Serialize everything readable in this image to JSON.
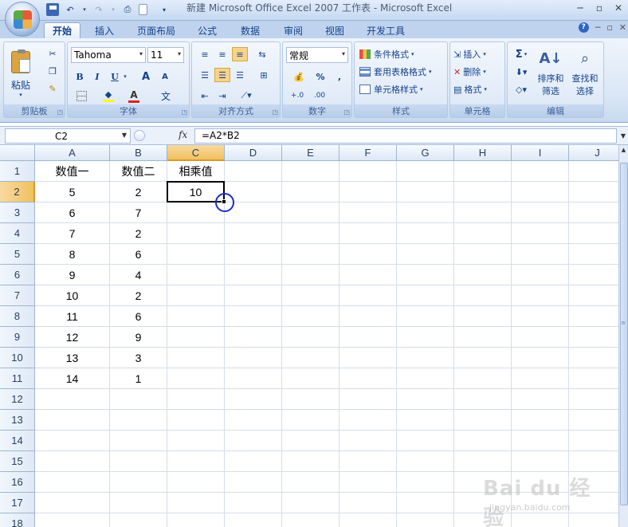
{
  "window": {
    "title": "新建 Microsoft Office Excel 2007 工作表 - Microsoft Excel",
    "controls": [
      "─",
      "▫",
      "✕"
    ]
  },
  "tabs": [
    "开始",
    "插入",
    "页面布局",
    "公式",
    "数据",
    "审阅",
    "视图",
    "开发工具"
  ],
  "ribbon": {
    "clipboard": {
      "paste_label": "粘贴",
      "group_label": "剪贴板"
    },
    "font": {
      "font_name": "Tahoma",
      "font_size": "11",
      "group_label": "字体",
      "bold": "B",
      "italic": "I",
      "underline": "U",
      "grow": "A",
      "shrink": "A",
      "phonetic": "文"
    },
    "alignment": {
      "group_label": "对齐方式"
    },
    "number": {
      "format": "常规",
      "percent": "%",
      "comma": ",",
      "group_label": "数字",
      "dec_inc": "+.0",
      "dec_dec": ".00"
    },
    "styles": {
      "conditional": "条件格式",
      "table": "套用表格格式",
      "cell": "单元格样式",
      "group_label": "样式"
    },
    "cells": {
      "insert": "插入",
      "delete": "删除",
      "format": "格式",
      "group_label": "单元格"
    },
    "editing": {
      "sigma": "Σ",
      "sort_line1": "排序和",
      "sort_line2": "筛选",
      "find_line1": "查找和",
      "find_line2": "选择",
      "group_label": "编辑"
    }
  },
  "formula_bar": {
    "name_box": "C2",
    "fx": "fx",
    "formula": "=A2*B2"
  },
  "sheet": {
    "columns": [
      "A",
      "B",
      "C",
      "D",
      "E",
      "F",
      "G",
      "H",
      "I",
      "J"
    ],
    "selected_column": "C",
    "selected_row": 2,
    "rows": [
      {
        "n": "1",
        "A": "数值一",
        "B": "数值二",
        "C": "相乘值"
      },
      {
        "n": "2",
        "A": "5",
        "B": "2",
        "C": "10"
      },
      {
        "n": "3",
        "A": "6",
        "B": "7",
        "C": ""
      },
      {
        "n": "4",
        "A": "7",
        "B": "2",
        "C": ""
      },
      {
        "n": "5",
        "A": "8",
        "B": "6",
        "C": ""
      },
      {
        "n": "6",
        "A": "9",
        "B": "4",
        "C": ""
      },
      {
        "n": "7",
        "A": "10",
        "B": "2",
        "C": ""
      },
      {
        "n": "8",
        "A": "11",
        "B": "6",
        "C": ""
      },
      {
        "n": "9",
        "A": "12",
        "B": "9",
        "C": ""
      },
      {
        "n": "10",
        "A": "13",
        "B": "3",
        "C": ""
      },
      {
        "n": "11",
        "A": "14",
        "B": "1",
        "C": ""
      },
      {
        "n": "12",
        "A": "",
        "B": "",
        "C": ""
      },
      {
        "n": "13",
        "A": "",
        "B": "",
        "C": ""
      },
      {
        "n": "14",
        "A": "",
        "B": "",
        "C": ""
      },
      {
        "n": "15",
        "A": "",
        "B": "",
        "C": ""
      },
      {
        "n": "16",
        "A": "",
        "B": "",
        "C": ""
      },
      {
        "n": "17",
        "A": "",
        "B": "",
        "C": ""
      },
      {
        "n": "18",
        "A": "",
        "B": "",
        "C": ""
      }
    ]
  },
  "watermark": {
    "main": "Bai du 经验",
    "sub": "jingyan.baidu.com"
  }
}
